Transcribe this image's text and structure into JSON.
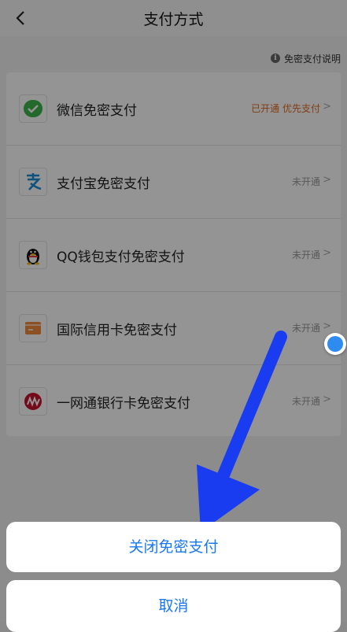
{
  "nav": {
    "title": "支付方式"
  },
  "help": {
    "text": "免密支付说明"
  },
  "methods": [
    {
      "label": "微信免密支付",
      "status": "已开通 优先支付",
      "icon": "wechat-icon"
    },
    {
      "label": "支付宝免密支付",
      "status": "未开通",
      "icon": "alipay-icon"
    },
    {
      "label": "QQ钱包支付免密支付",
      "status": "未开通",
      "icon": "qq-wallet-icon"
    },
    {
      "label": "国际信用卡免密支付",
      "status": "未开通",
      "icon": "credit-card-icon"
    },
    {
      "label": "一网通银行卡免密支付",
      "status": "未开通",
      "icon": "cmb-bank-icon"
    }
  ],
  "sheet": {
    "confirm_label": "关闭免密支付",
    "cancel_label": "取消"
  },
  "colors": {
    "accent": "#1978f0",
    "enabled_status": "#e06a1c",
    "arrow": "#1a3cf0"
  }
}
